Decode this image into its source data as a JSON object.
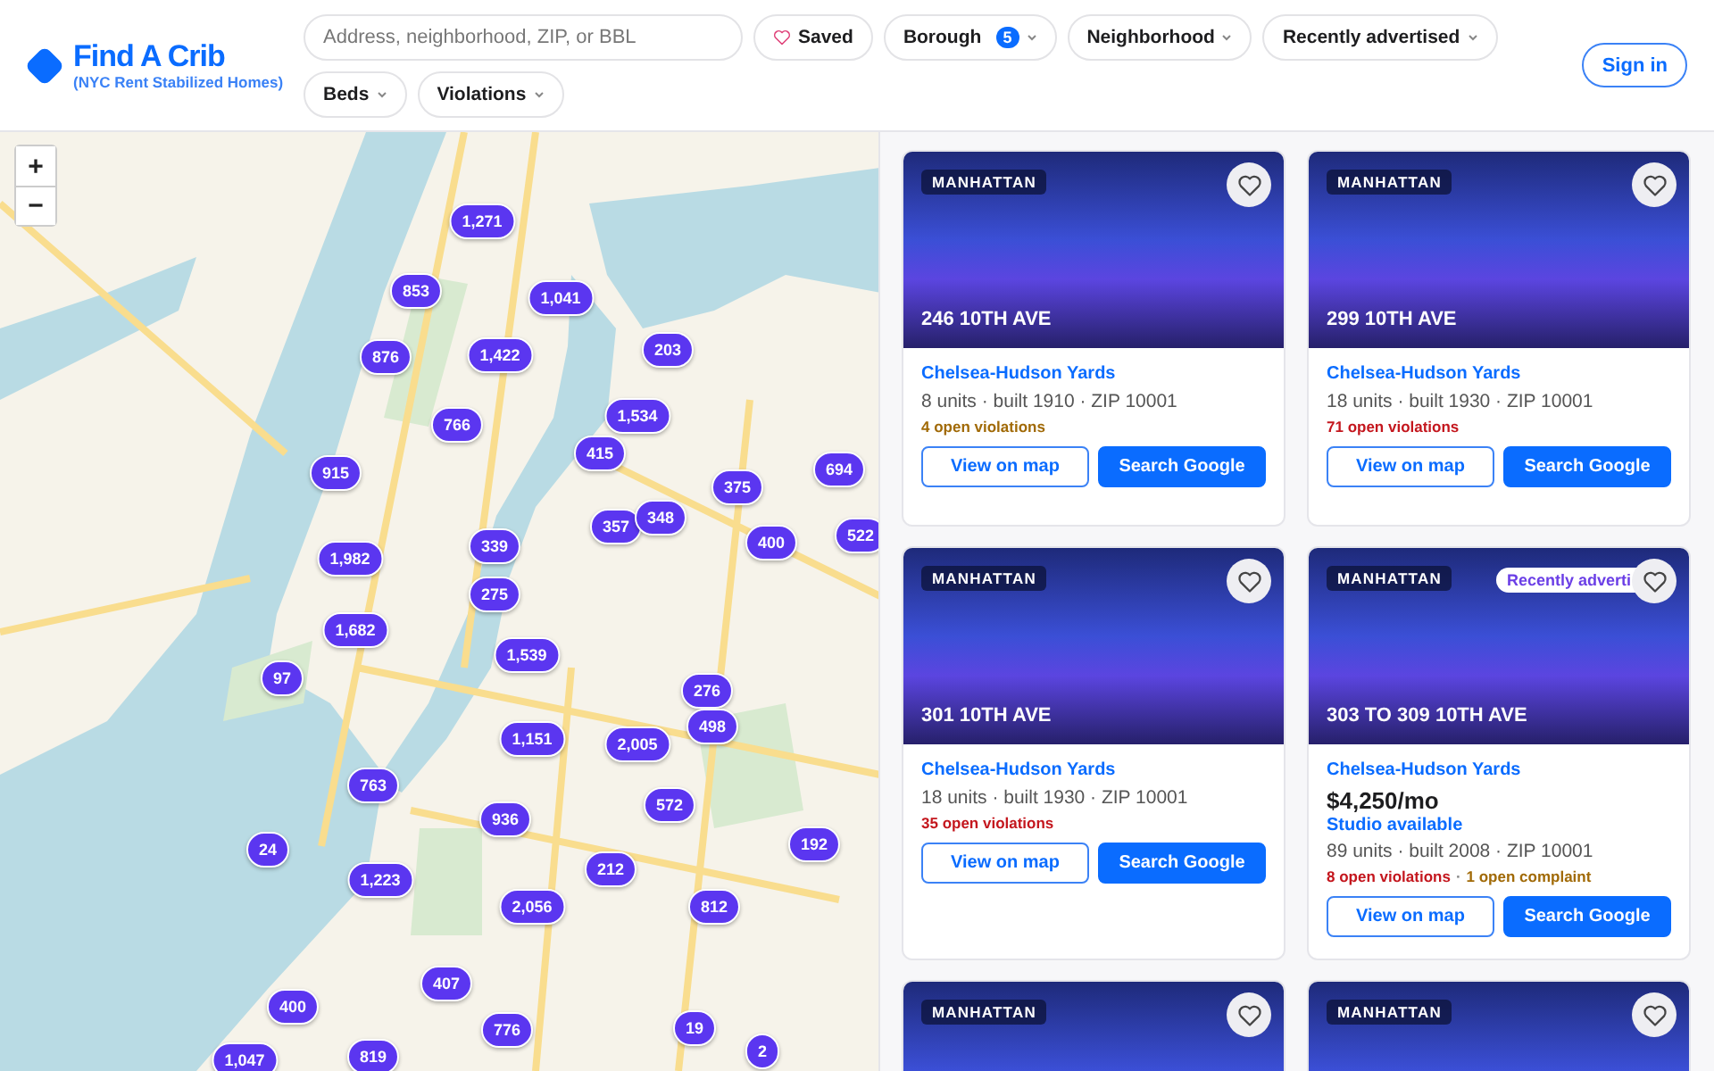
{
  "brand": {
    "title": "Find A Crib",
    "subtitle": "(NYC Rent Stabilized Homes)"
  },
  "search": {
    "placeholder": "Address, neighborhood, ZIP, or BBL"
  },
  "filters": [
    {
      "kind": "saved",
      "label": "Saved"
    },
    {
      "kind": "dropdown",
      "label": "Borough",
      "count": "5"
    },
    {
      "kind": "dropdown",
      "label": "Neighborhood"
    },
    {
      "kind": "dropdown",
      "label": "Recently advertised"
    },
    {
      "kind": "dropdown",
      "label": "Beds"
    },
    {
      "kind": "dropdown",
      "label": "Violations"
    }
  ],
  "sign_in": "Sign in",
  "map": {
    "zoom_in": "+",
    "zoom_out": "−",
    "clusters": [
      "1,271",
      "853",
      "1,041",
      "876",
      "1,422",
      "203",
      "1,534",
      "766",
      "415",
      "915",
      "375",
      "694",
      "357",
      "348",
      "400",
      "522",
      "1,982",
      "339",
      "275",
      "1,682",
      "1,539",
      "97",
      "276",
      "498",
      "1,151",
      "2,005",
      "763",
      "936",
      "572",
      "24",
      "192",
      "212",
      "1,223",
      "2,056",
      "812",
      "407",
      "400",
      "776",
      "19",
      "2",
      "1,047",
      "819"
    ]
  },
  "listings": [
    {
      "borough": "MANHATTAN",
      "address": "246 10TH AVE",
      "neighborhood": "Chelsea-Hudson Yards",
      "details": "8 units · built 1910 · ZIP 10001",
      "issues": [
        {
          "text": "4 open violations",
          "color": "#a16a07"
        }
      ],
      "actions": [
        "View on map",
        "Search Google"
      ]
    },
    {
      "borough": "MANHATTAN",
      "address": "299 10TH AVE",
      "neighborhood": "Chelsea-Hudson Yards",
      "details": "18 units · built 1930 · ZIP 10001",
      "issues": [
        {
          "text": "71 open violations",
          "color": "#c4171e"
        }
      ],
      "actions": [
        "View on map",
        "Search Google"
      ]
    },
    {
      "borough": "MANHATTAN",
      "address": "301 10TH AVE",
      "neighborhood": "Chelsea-Hudson Yards",
      "details": "18 units · built 1930 · ZIP 10001",
      "issues": [
        {
          "text": "35 open violations",
          "color": "#c4171e"
        }
      ],
      "actions": [
        "View on map",
        "Search Google"
      ]
    },
    {
      "borough": "MANHATTAN",
      "address": "303 TO 309 10TH AVE",
      "tag": "Recently adverti",
      "neighborhood": "Chelsea-Hudson Yards",
      "price": "$4,250/mo",
      "availability": "Studio available",
      "details": "89 units · built 2008 · ZIP 10001",
      "issues": [
        {
          "text": "8 open violations",
          "color": "#c4171e"
        },
        {
          "text": "1 open complaint",
          "color": "#a16a07"
        }
      ],
      "issue_separator": "·",
      "actions": [
        "View on map",
        "Search Google"
      ]
    },
    {
      "borough": "MANHATTAN"
    },
    {
      "borough": "MANHATTAN"
    }
  ]
}
